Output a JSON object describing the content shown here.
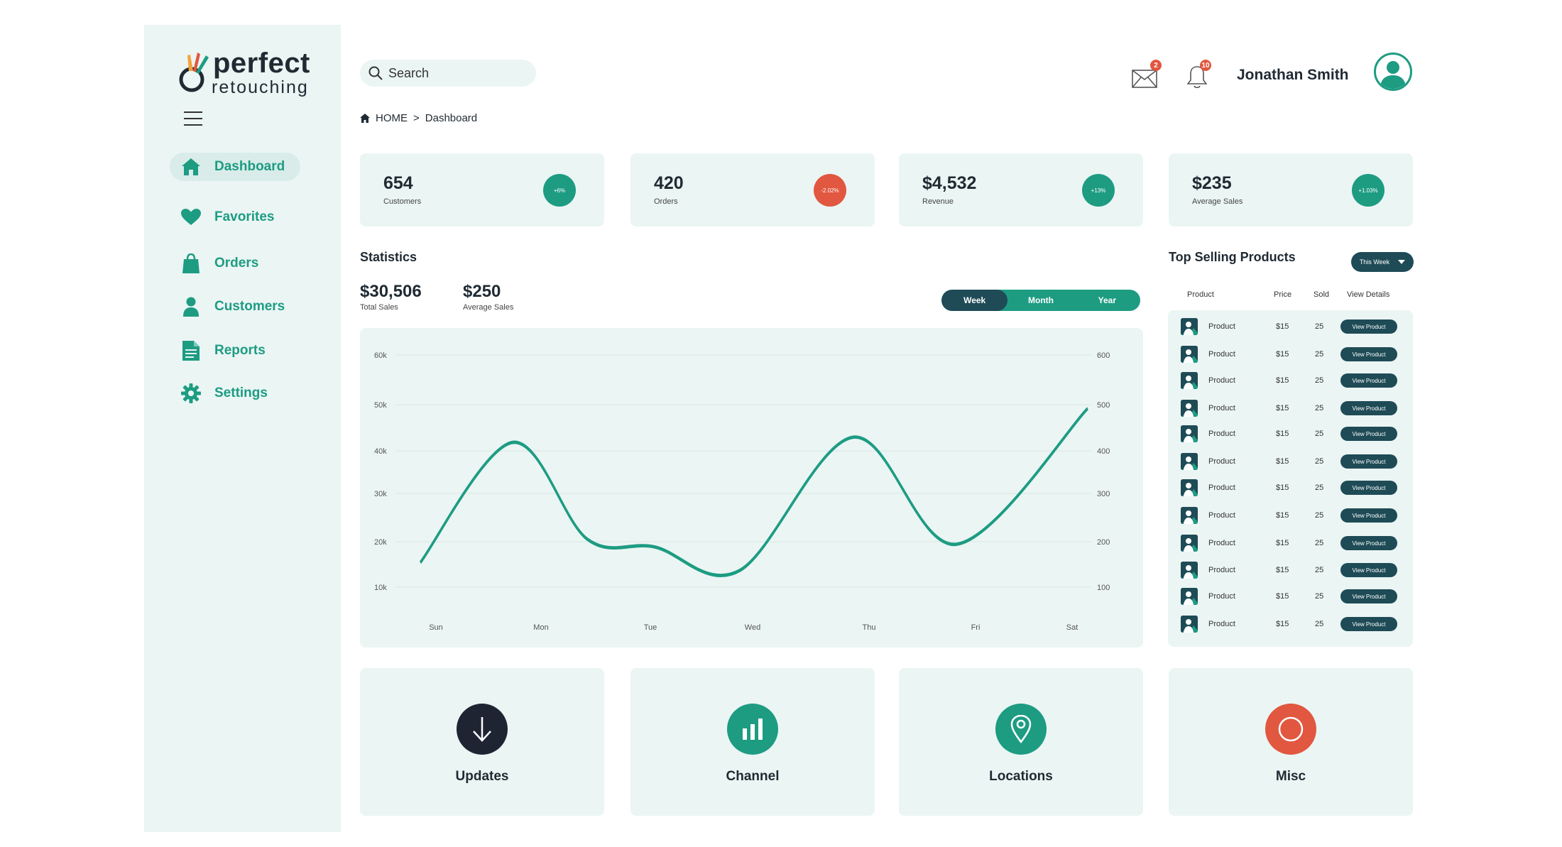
{
  "brand": {
    "line1": "perfect",
    "line2": "retouching"
  },
  "nav": [
    {
      "label": "Dashboard",
      "icon": "home-icon",
      "active": true
    },
    {
      "label": "Favorites",
      "icon": "heart-icon"
    },
    {
      "label": "Orders",
      "icon": "shopping-bag-icon"
    },
    {
      "label": "Customers",
      "icon": "user-icon"
    },
    {
      "label": "Reports",
      "icon": "document-icon"
    },
    {
      "label": "Settings",
      "icon": "gear-icon"
    }
  ],
  "search": {
    "placeholder": "Search"
  },
  "header": {
    "mail_count": "2",
    "notif_count": "10",
    "username": "Jonathan Smith"
  },
  "breadcrumb": {
    "home": "HOME",
    "sep": ">",
    "current": "Dashboard"
  },
  "stats": [
    {
      "value": "654",
      "label": "Customers",
      "change": "+6%",
      "color": "#1d9c82"
    },
    {
      "value": "420",
      "label": "Orders",
      "change": "-2.02%",
      "color": "#e1573f"
    },
    {
      "value": "$4,532",
      "label": "Revenue",
      "change": "+13%",
      "color": "#1d9c82"
    },
    {
      "value": "$235",
      "label": "Average Sales",
      "change": "+1.03%",
      "color": "#1d9c82"
    }
  ],
  "statistics": {
    "title": "Statistics",
    "total_sales": "$30,506",
    "total_sales_label": "Total Sales",
    "avg_sales": "$250",
    "avg_sales_label": "Average Sales",
    "range_options": [
      "Week",
      "Month",
      "Year"
    ],
    "range_active": "Week"
  },
  "chart_data": {
    "type": "line",
    "categories": [
      "Sun",
      "Mon",
      "Tue",
      "Wed",
      "Thu",
      "Fri",
      "Sat"
    ],
    "y_left_ticks": [
      "60k",
      "50k",
      "40k",
      "30k",
      "20k",
      "10k"
    ],
    "y_right_ticks": [
      "600",
      "500",
      "400",
      "300",
      "200",
      "100"
    ],
    "ylim": [
      10000,
      60000
    ],
    "series": [
      {
        "values": [
          17500,
          40500,
          22000,
          20500,
          16000,
          41500,
          21000,
          47000
        ]
      }
    ],
    "x": [
      0,
      0.8,
      1.8,
      2.5,
      3.1,
      4.2,
      5.0,
      6.2
    ],
    "color": "#1d9c82",
    "grid": true
  },
  "top_products": {
    "title": "Top Selling Products",
    "filter": "This Week",
    "columns": [
      "Product",
      "Price",
      "Sold",
      "View Details"
    ],
    "rows": [
      {
        "name": "Product",
        "price": "$15",
        "sold": "25",
        "action": "View Product"
      },
      {
        "name": "Product",
        "price": "$15",
        "sold": "25",
        "action": "View Product"
      },
      {
        "name": "Product",
        "price": "$15",
        "sold": "25",
        "action": "View Product"
      },
      {
        "name": "Product",
        "price": "$15",
        "sold": "25",
        "action": "View Product"
      },
      {
        "name": "Product",
        "price": "$15",
        "sold": "25",
        "action": "View Product"
      },
      {
        "name": "Product",
        "price": "$15",
        "sold": "25",
        "action": "View Product"
      },
      {
        "name": "Product",
        "price": "$15",
        "sold": "25",
        "action": "View Product"
      },
      {
        "name": "Product",
        "price": "$15",
        "sold": "25",
        "action": "View Product"
      },
      {
        "name": "Product",
        "price": "$15",
        "sold": "25",
        "action": "View Product"
      },
      {
        "name": "Product",
        "price": "$15",
        "sold": "25",
        "action": "View Product"
      },
      {
        "name": "Product",
        "price": "$15",
        "sold": "25",
        "action": "View Product"
      },
      {
        "name": "Product",
        "price": "$15",
        "sold": "25",
        "action": "View Product"
      }
    ]
  },
  "tiles": [
    {
      "label": "Updates",
      "icon": "download-icon",
      "color": "#1f2433"
    },
    {
      "label": "Channel",
      "icon": "bar-chart-icon",
      "color": "#1d9c82"
    },
    {
      "label": "Locations",
      "icon": "location-pin-icon",
      "color": "#1d9c82"
    },
    {
      "label": "Misc",
      "icon": "circle-icon",
      "color": "#e1573f"
    }
  ],
  "colors": {
    "accent": "#1d9c82",
    "dark": "#1e4b56",
    "danger": "#e1573f",
    "panel": "#ebf5f4"
  }
}
